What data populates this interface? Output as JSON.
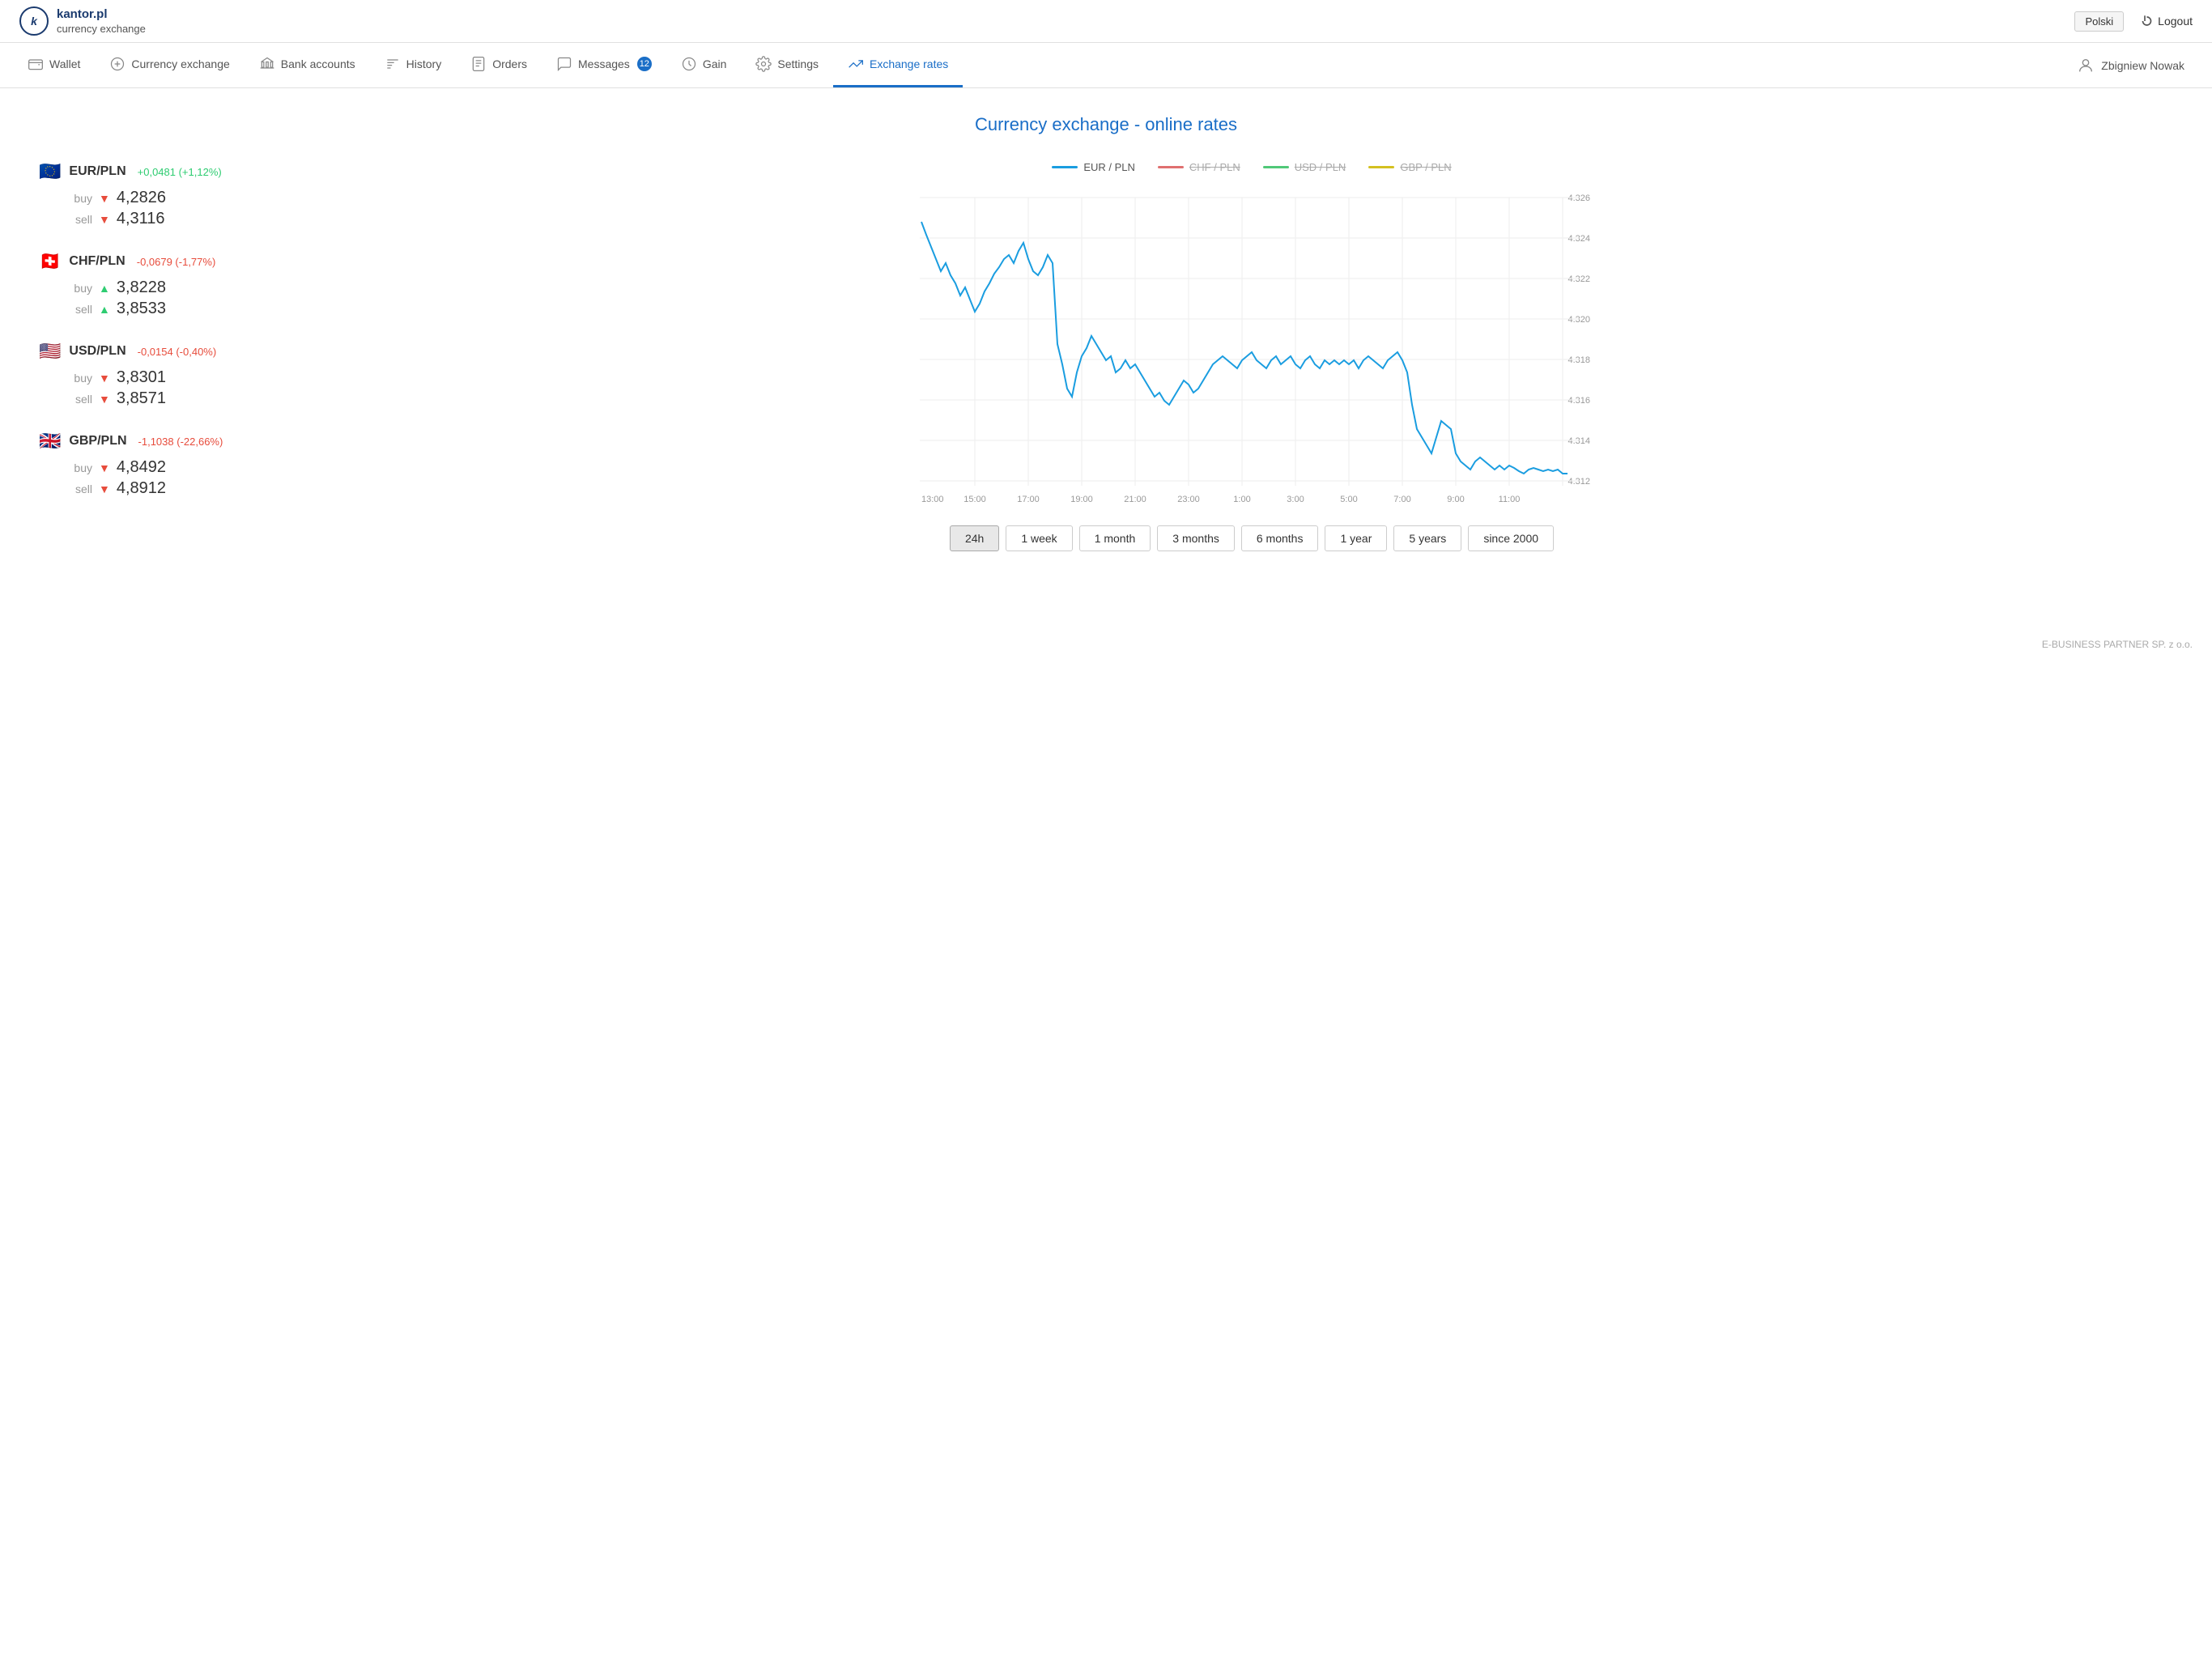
{
  "brand": {
    "k_letter": "k",
    "domain": "kantor.pl",
    "subtitle_line1": "currency",
    "subtitle_line2": "exchange"
  },
  "topbar": {
    "lang_button": "Polski",
    "logout_label": "Logout"
  },
  "nav": {
    "items": [
      {
        "id": "wallet",
        "label": "Wallet",
        "icon": "💳",
        "active": false
      },
      {
        "id": "currency-exchange",
        "label": "Currency exchange",
        "icon": "💱",
        "active": false
      },
      {
        "id": "bank-accounts",
        "label": "Bank accounts",
        "icon": "🏛",
        "active": false
      },
      {
        "id": "history",
        "label": "History",
        "icon": "📄",
        "active": false
      },
      {
        "id": "orders",
        "label": "Orders",
        "icon": "📋",
        "active": false
      },
      {
        "id": "messages",
        "label": "Messages",
        "icon": "💬",
        "active": false,
        "badge": "12"
      },
      {
        "id": "gain",
        "label": "Gain",
        "icon": "💰",
        "active": false
      },
      {
        "id": "settings",
        "label": "Settings",
        "icon": "⚙️",
        "active": false
      },
      {
        "id": "exchange-rates",
        "label": "Exchange rates",
        "icon": "📈",
        "active": true
      }
    ],
    "user": "Zbigniew Nowak"
  },
  "page": {
    "title": "Currency exchange - online rates"
  },
  "currencies": [
    {
      "id": "eur",
      "name": "EUR/PLN",
      "change": "+0,0481 (+1,12%)",
      "change_type": "positive",
      "buy_arrow": "down",
      "sell_arrow": "down",
      "buy": "4,2826",
      "sell": "4,3116",
      "flag": "eu"
    },
    {
      "id": "chf",
      "name": "CHF/PLN",
      "change": "-0,0679 (-1,77%)",
      "change_type": "negative",
      "buy_arrow": "up",
      "sell_arrow": "up",
      "buy": "3,8228",
      "sell": "3,8533",
      "flag": "ch"
    },
    {
      "id": "usd",
      "name": "USD/PLN",
      "change": "-0,0154 (-0,40%)",
      "change_type": "negative",
      "buy_arrow": "down",
      "sell_arrow": "down",
      "buy": "3,8301",
      "sell": "3,8571",
      "flag": "us"
    },
    {
      "id": "gbp",
      "name": "GBP/PLN",
      "change": "-1,1038 (-22,66%)",
      "change_type": "negative",
      "buy_arrow": "down",
      "sell_arrow": "down",
      "buy": "4,8492",
      "sell": "4,8912",
      "flag": "gb"
    }
  ],
  "chart": {
    "legend": [
      {
        "id": "eur",
        "label": "EUR / PLN",
        "color_class": "eur",
        "active": true
      },
      {
        "id": "chf",
        "label": "CHF / PLN",
        "color_class": "chf",
        "active": false
      },
      {
        "id": "usd",
        "label": "USD / PLN",
        "color_class": "usd",
        "active": false
      },
      {
        "id": "gbp",
        "label": "GBP / PLN",
        "color_class": "gbp",
        "active": false
      }
    ],
    "y_axis": {
      "max": "4.326",
      "values": [
        "4.326",
        "4.324",
        "4.322",
        "4.320",
        "4.318",
        "4.316",
        "4.314",
        "4.312"
      ]
    },
    "x_axis": {
      "labels": [
        "13:00",
        "15:00",
        "17:00",
        "19:00",
        "21:00",
        "23:00",
        "1:00",
        "3:00",
        "5:00",
        "7:00",
        "9:00",
        "11:00"
      ]
    },
    "time_buttons": [
      {
        "id": "24h",
        "label": "24h",
        "active": true
      },
      {
        "id": "1week",
        "label": "1 week",
        "active": false
      },
      {
        "id": "1month",
        "label": "1 month",
        "active": false
      },
      {
        "id": "3months",
        "label": "3 months",
        "active": false
      },
      {
        "id": "6months",
        "label": "6 months",
        "active": false
      },
      {
        "id": "1year",
        "label": "1 year",
        "active": false
      },
      {
        "id": "5years",
        "label": "5 years",
        "active": false
      },
      {
        "id": "since2000",
        "label": "since 2000",
        "active": false
      }
    ]
  },
  "footer": {
    "text": "E-BUSINESS PARTNER SP. z o.o."
  }
}
